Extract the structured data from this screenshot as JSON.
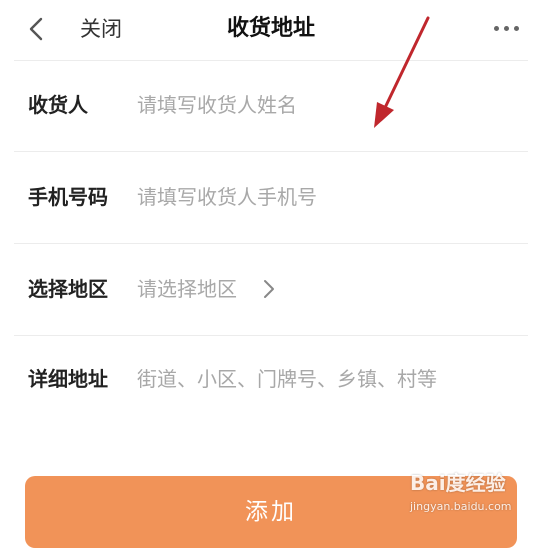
{
  "header": {
    "close_label": "关闭",
    "title": "收货地址",
    "back_icon": "chevron-left-icon",
    "more_icon": "more-horizontal-icon"
  },
  "form": {
    "recipient": {
      "label": "收货人",
      "placeholder": "请填写收货人姓名"
    },
    "phone": {
      "label": "手机号码",
      "placeholder": "请填写收货人手机号"
    },
    "region": {
      "label": "选择地区",
      "placeholder": "请选择地区",
      "icon": "chevron-right-icon"
    },
    "address": {
      "label": "详细地址",
      "placeholder": "街道、小区、门牌号、乡镇、村等"
    }
  },
  "actions": {
    "add_label": "添加"
  },
  "watermark": {
    "logo_text": "Bai度经验",
    "url": "jingyan.baidu.com"
  },
  "colors": {
    "accent": "#f19358",
    "annotation_arrow": "#c0272d",
    "placeholder": "#a8a8a8",
    "divider": "#ececec"
  }
}
